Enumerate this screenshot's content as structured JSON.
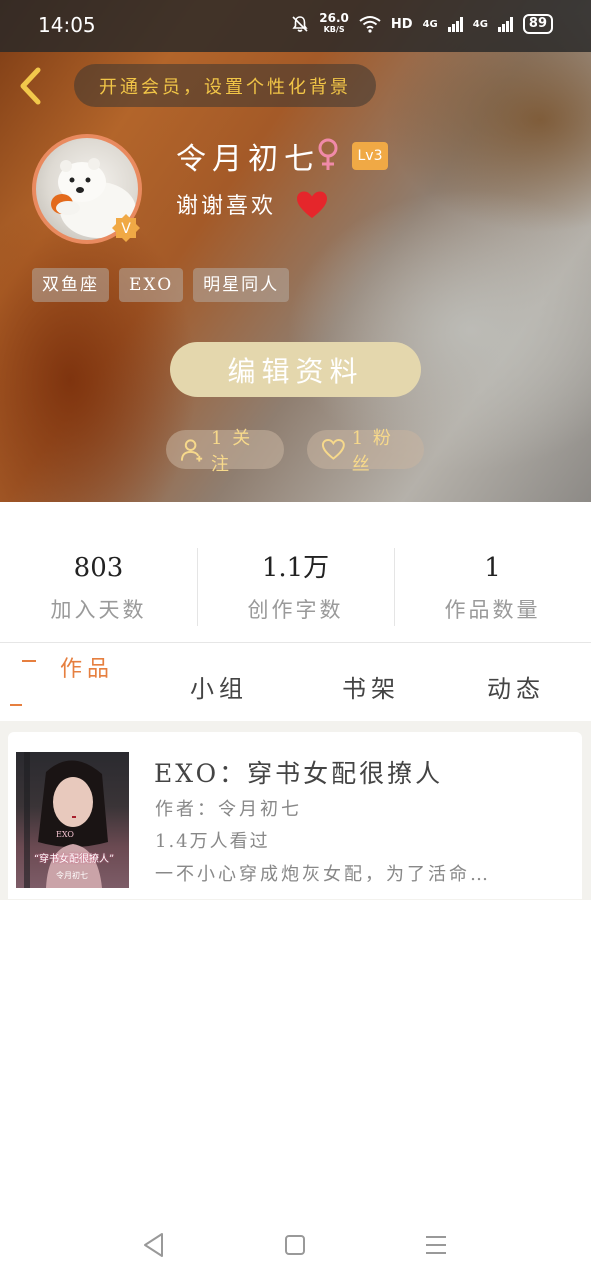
{
  "status_bar": {
    "time": "14:05",
    "net_speed": "26.0",
    "net_speed_unit": "KB/S",
    "hd_label": "HD",
    "network_1": "4G",
    "network_2": "4G",
    "battery": "89"
  },
  "header": {
    "vip_banner": "开通会员，设置个性化背景",
    "username": "令月初七",
    "level": "Lv3",
    "signature": "谢谢喜欢",
    "tags": [
      "双鱼座",
      "EXO",
      "明星同人"
    ],
    "edit_profile_label": "编辑资料",
    "following_label": "1 关注",
    "fans_label": "1 粉丝"
  },
  "stats": [
    {
      "value": "803",
      "label": "加入天数"
    },
    {
      "value": "1.1万",
      "label": "创作字数"
    },
    {
      "value": "1",
      "label": "作品数量"
    }
  ],
  "tabs": {
    "works": "作品",
    "groups": "小组",
    "bookshelf": "书架",
    "activity": "动态"
  },
  "books": [
    {
      "title": "EXO：穿书女配很撩人",
      "author": "作者：令月初七",
      "reads": "1.4万人看过",
      "description": "一不小心穿成炮灰女配，为了活命…",
      "cover_text_top": "EXO",
      "cover_text_main": "“穿书女配很撩人”",
      "cover_text_author": "令月初七"
    }
  ],
  "colors": {
    "accent_orange": "#e67f3f",
    "level_badge": "#f0a945",
    "vip_text": "#f1c547",
    "edit_button": "#e4d7ad"
  }
}
